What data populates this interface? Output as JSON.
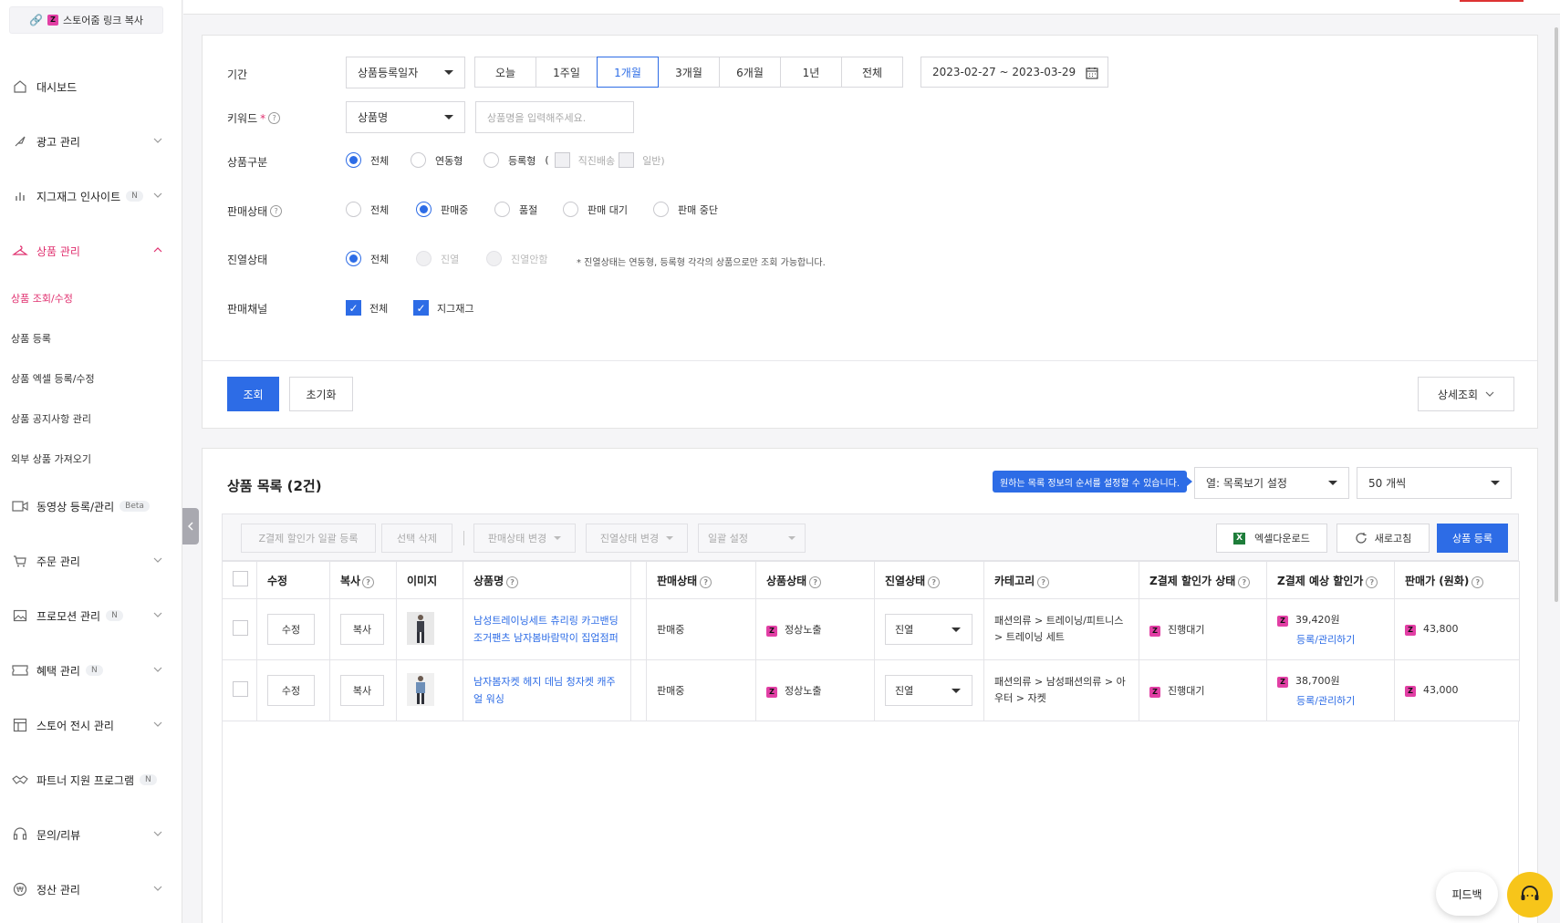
{
  "sidebar": {
    "copy_link_label": "스토어줌 링크 복사",
    "items": [
      {
        "label": "대시보드",
        "icon": "home-icon"
      },
      {
        "label": "광고 관리",
        "icon": "rocket-icon"
      },
      {
        "label": "지그재그 인사이트",
        "badge": "N",
        "icon": "bar-chart-icon"
      },
      {
        "label": "상품 관리",
        "icon": "hanger-icon"
      },
      {
        "label": "동영상 등록/관리",
        "badge": "Beta",
        "icon": "video-icon"
      },
      {
        "label": "주문 관리",
        "icon": "cart-icon"
      },
      {
        "label": "프로모션 관리",
        "badge": "N",
        "icon": "image-icon"
      },
      {
        "label": "혜택 관리",
        "badge": "N",
        "icon": "ticket-icon"
      },
      {
        "label": "스토어 전시 관리",
        "icon": "layout-icon"
      },
      {
        "label": "파트너 지원 프로그램",
        "badge": "N",
        "icon": "handshake-icon"
      },
      {
        "label": "문의/리뷰",
        "icon": "headset-icon"
      },
      {
        "label": "정산 관리",
        "icon": "won-icon"
      }
    ],
    "sub_items": [
      "상품 조회/수정",
      "상품 등록",
      "상품 엑셀 등록/수정",
      "상품 공지사항 관리",
      "외부 상품 가져오기"
    ]
  },
  "filters": {
    "period_label": "기간",
    "period_select": "상품등록일자",
    "period_buttons": [
      "오늘",
      "1주일",
      "1개월",
      "3개월",
      "6개월",
      "1년",
      "전체"
    ],
    "date_range": "2023-02-27 ~ 2023-03-29",
    "keyword_label": "키워드",
    "keyword_required": "*",
    "keyword_select": "상품명",
    "keyword_placeholder": "상품명을 입력해주세요.",
    "type_label": "상품구분",
    "type_options": [
      "전체",
      "연동형",
      "등록형"
    ],
    "type_sub_open": "(",
    "type_sub": [
      "직진배송",
      "일반)"
    ],
    "sale_label": "판매상태",
    "sale_options": [
      "전체",
      "판매중",
      "품절",
      "판매 대기",
      "판매 중단"
    ],
    "display_label": "진열상태",
    "display_options": [
      "전체",
      "진열",
      "진열안함"
    ],
    "display_note": "* 진열상태는 연동형, 등록형 각각의 상품으로만 조회 가능합니다.",
    "channel_label": "판매채널",
    "channel_options": [
      "전체",
      "지그재그"
    ],
    "search_btn": "조회",
    "reset_btn": "초기화",
    "detail_btn": "상세조회"
  },
  "list": {
    "title": "상품 목록 (2건)",
    "tooltip": "원하는 목록 정보의 순서를 설정할 수 있습니다.",
    "column_select": "열: 목록보기 설정",
    "page_size": "50 개씩",
    "toolbar": {
      "zpay_bulk": "Z결제 할인가 일괄 등록",
      "delete": "선택 삭제",
      "sale_change": "판매상태 변경",
      "display_change": "진열상태 변경",
      "bulk_setting": "일괄 설정",
      "excel": "엑셀다운로드",
      "refresh": "새로고침",
      "register": "상품 등록"
    },
    "columns": [
      "수정",
      "복사",
      "이미지",
      "상품명",
      "판매상태",
      "상품상태",
      "진열상태",
      "카테고리",
      "Z결제 할인가 상태",
      "Z결제 예상 할인가",
      "판매가 (원화)"
    ],
    "rows": [
      {
        "edit": "수정",
        "copy": "복사",
        "name": "남성트레이닝세트 츄리링 카고밴딩조거팬츠 남자봄바람막이 집업점퍼",
        "sale_status": "판매중",
        "product_status": "정상노출",
        "display": "진열",
        "category": "패션의류 > 트레이닝/피트니스 > 트레이닝 세트",
        "zpay_status": "진행대기",
        "zpay_price": "39,420원",
        "zpay_link": "등록/관리하기",
        "price": "43,800"
      },
      {
        "edit": "수정",
        "copy": "복사",
        "name": "남자봄자켓 헤지 데님 청자켓 캐주얼 워싱",
        "sale_status": "판매중",
        "product_status": "정상노출",
        "display": "진열",
        "category": "패션의류 > 남성패션의류 > 아우터 > 자켓",
        "zpay_status": "진행대기",
        "zpay_price": "38,700원",
        "zpay_link": "등록/관리하기",
        "price": "43,000"
      }
    ]
  },
  "floating": {
    "feedback": "피드백"
  },
  "colors": {
    "accent": "#2d6ce6",
    "brand_pink": "#e0306f",
    "zbadge": "#e23fa5"
  }
}
